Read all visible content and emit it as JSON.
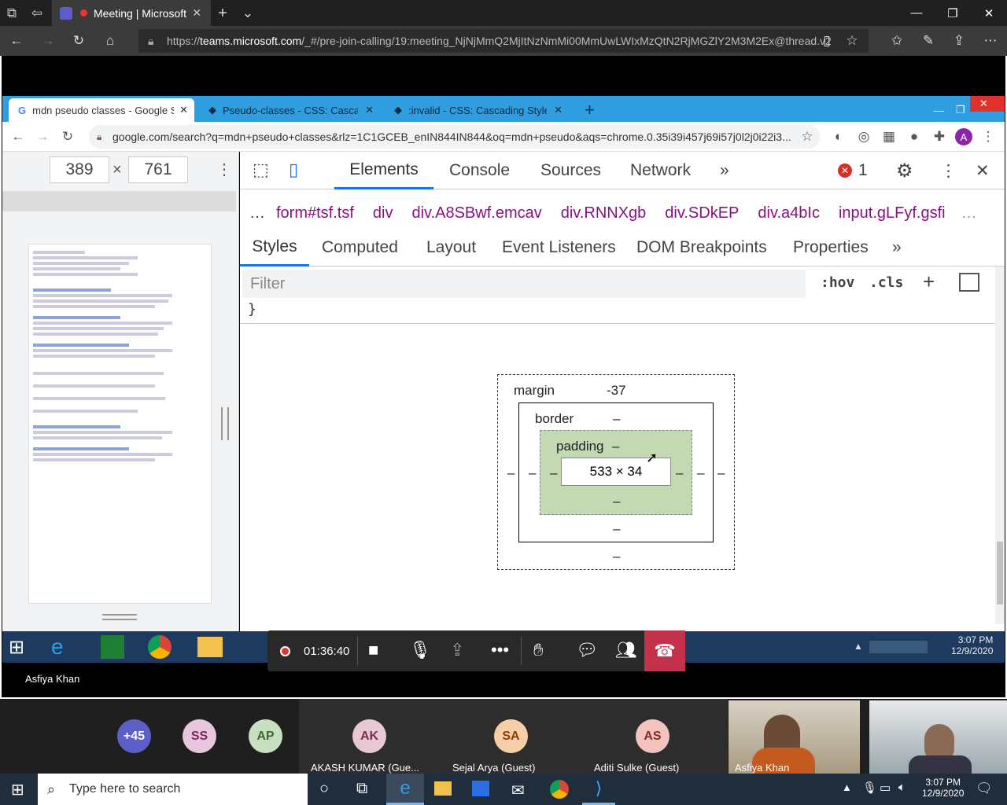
{
  "edge": {
    "tab_title": "Meeting | Microsoft",
    "url_prefix": "https://",
    "url_host": "teams.microsoft.com",
    "url_rest": "/_#/pre-join-calling/19:meeting_NjNjMmQ2MjItNzNmMi00MmUwLWIxMzQtN2RjMGZlY2M3M2Ex@thread.v2"
  },
  "chrome": {
    "tabs": [
      {
        "label": "mdn pseudo classes - Google Se"
      },
      {
        "label": "Pseudo-classes - CSS: Cascading"
      },
      {
        "label": ":invalid - CSS: Cascading Style Sh"
      }
    ],
    "url": "google.com/search?q=mdn+pseudo+classes&rlz=1C1GCEB_enIN844IN844&oq=mdn+pseudo&aqs=chrome.0.35i39i457j69i57j0l2j0i22i3...",
    "profile_initial": "A"
  },
  "device": {
    "width": "389",
    "times": "×",
    "height": "761"
  },
  "devtools": {
    "tabs": [
      "Elements",
      "Console",
      "Sources",
      "Network"
    ],
    "more": "»",
    "error_count": "1",
    "breadcrumbs": [
      "…",
      "form#tsf.tsf",
      "div",
      "div.A8SBwf.emcav",
      "div.RNNXgb",
      "div.SDkEP",
      "div.a4bIc",
      "input.gLFyf.gsfi",
      "…"
    ],
    "subtabs": [
      "Styles",
      "Computed",
      "Layout",
      "Event Listeners",
      "DOM Breakpoints",
      "Properties"
    ],
    "filter_placeholder": "Filter",
    "hov": ":hov",
    "cls": ".cls",
    "closing_brace": "}",
    "box_model": {
      "margin_label": "margin",
      "margin_top": "-37",
      "border_label": "border",
      "border_top": "–",
      "padding_label": "padding",
      "padding_top": "–",
      "content": "533 × 34",
      "dash": "–"
    }
  },
  "meeting": {
    "timer": "01:36:40",
    "presenter": "Asfiya Khan"
  },
  "shared_clock": {
    "time": "3:07 PM",
    "date": "12/9/2020"
  },
  "participants": [
    {
      "initials": "+45",
      "color": "#5b5fc7",
      "text_color": "#ffffff"
    },
    {
      "initials": "SS",
      "color": "#e8c6de",
      "text_color": "#7a2a5e"
    },
    {
      "initials": "AP",
      "color": "#c8e0c0",
      "text_color": "#3b6b2c"
    },
    {
      "initials": "AK",
      "color": "#e7c8d4",
      "text_color": "#7a2e4a",
      "name": "AKASH KUMAR (Gue..."
    },
    {
      "initials": "SA",
      "color": "#f6cfa8",
      "text_color": "#8a3b0a",
      "name": "Sejal Arya (Guest)"
    },
    {
      "initials": "AS",
      "color": "#f3c3bd",
      "text_color": "#8a2a22",
      "name": "Aditi Sulke (Guest)"
    },
    {
      "name": "Asfiya Khan"
    }
  ],
  "taskbar": {
    "search_placeholder": "Type here to search",
    "time": "3:07 PM",
    "date": "12/9/2020"
  }
}
